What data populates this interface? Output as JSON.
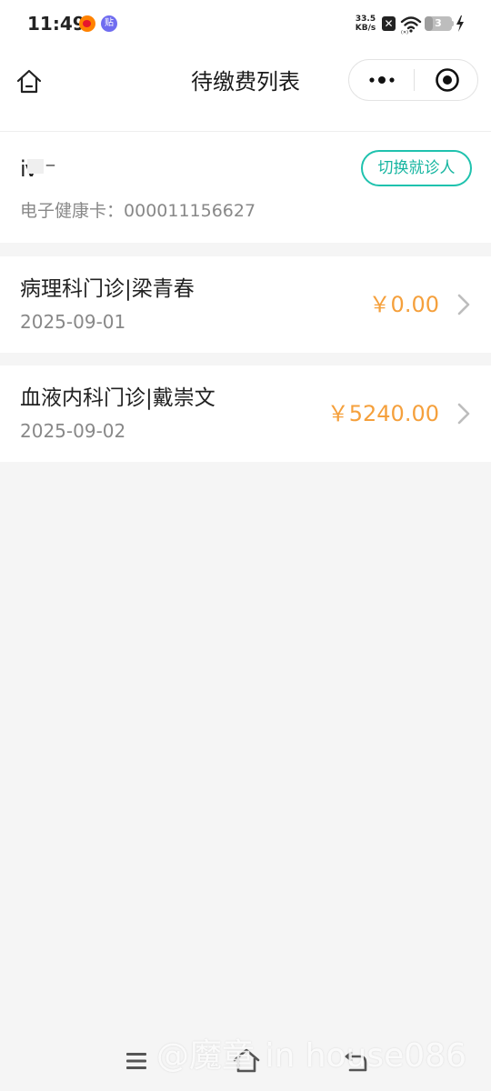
{
  "status_bar": {
    "time": "11:49",
    "app_icons": [
      "weibo-icon",
      "tieba-icon"
    ],
    "tieba_label": "贴",
    "net_speed_value": "33.5",
    "net_speed_unit": "KB/s",
    "x_badge": "✕",
    "battery_level": "3",
    "battery_fraction": 0.3
  },
  "nav": {
    "title": "待缴费列表"
  },
  "patient": {
    "name": "ⅳ  ⁻",
    "card_label": "电子健康卡：",
    "card_number": "000011156627",
    "switch_button": "切换就诊人"
  },
  "bills": [
    {
      "title": "病理科门诊|梁青春",
      "date": "2025-09-01",
      "amount": "￥0.00"
    },
    {
      "title": "血液内科门诊|戴崇文",
      "date": "2025-09-02",
      "amount": "￥5240.00"
    }
  ],
  "watermark": "@魔童 in house086",
  "colors": {
    "accent_teal": "#1fc2ae",
    "amount_orange": "#f5a03c",
    "background": "#f5f5f5"
  }
}
